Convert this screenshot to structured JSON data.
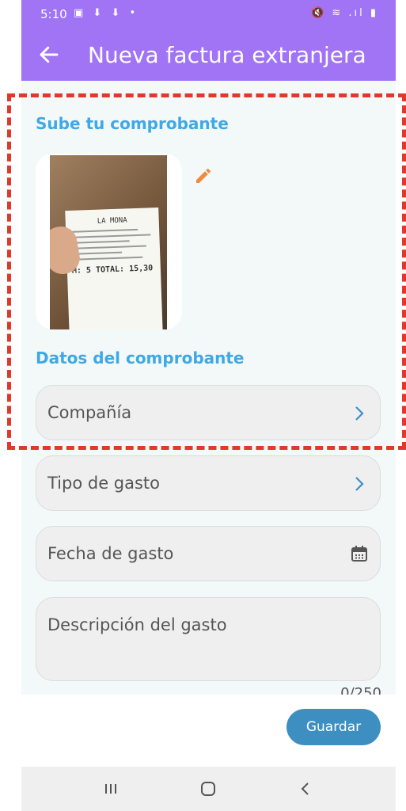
{
  "status_bar": {
    "time": "5:10",
    "left_icons": "▣ ⬇ ⬇ •",
    "right_icons": "🔇 ≋ .ıl ▮"
  },
  "app_bar": {
    "title": "Nueva factura extranjera",
    "back_icon": "arrow-left-icon",
    "color": "#a173f5"
  },
  "upload_section": {
    "title": "Sube tu comprobante",
    "receipt": {
      "shop": "LA MONA",
      "total": "M: 5 TOTAL: 15,30"
    },
    "edit_icon": "pencil-icon",
    "edit_color": "#f08a3c"
  },
  "data_section": {
    "title": "Datos del comprobante",
    "fields": {
      "company": "Compañía",
      "expense_type": "Tipo de gasto",
      "expense_date": "Fecha de gasto",
      "description": "Descripción del gasto"
    },
    "counter": "0/250"
  },
  "actions": {
    "save_label": "Guardar"
  },
  "colors": {
    "accent": "#3fa8e6",
    "button": "#3d8fc2",
    "highlight": "#e0392c"
  }
}
